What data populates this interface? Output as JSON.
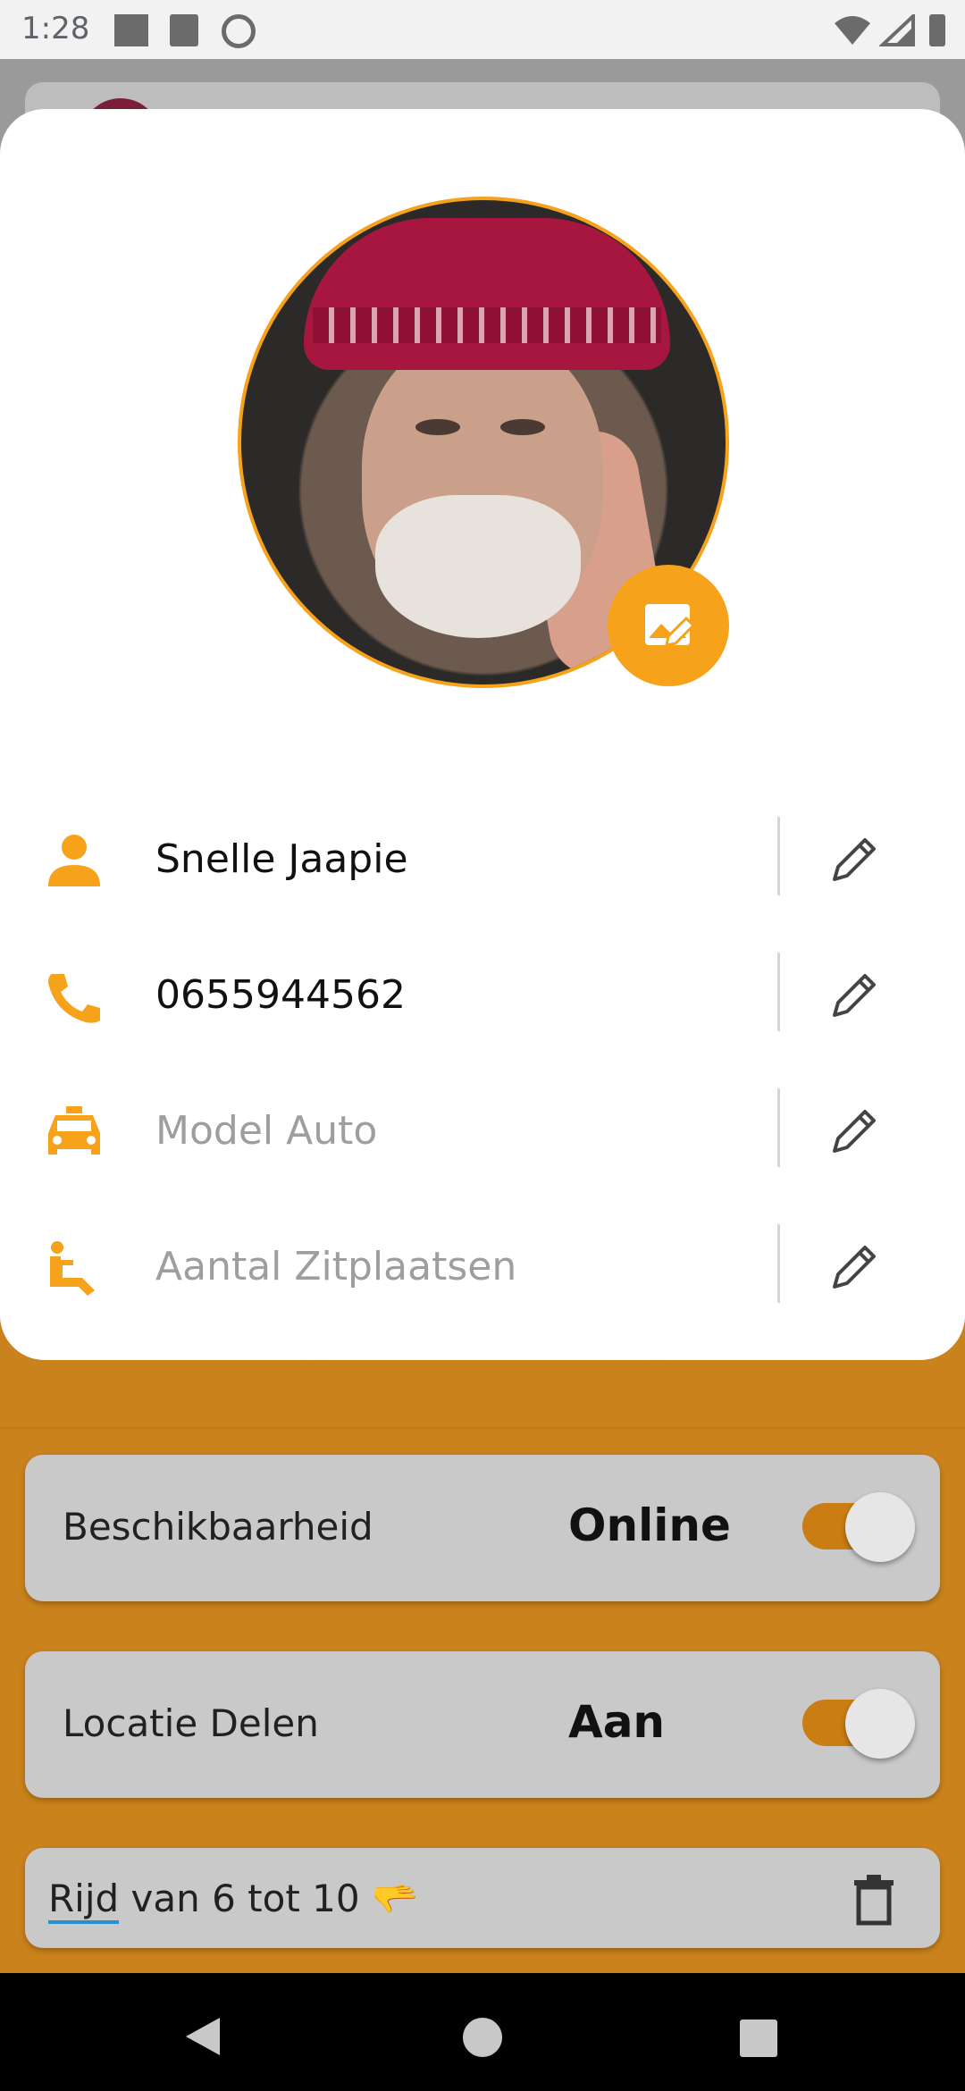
{
  "status_bar": {
    "time": "1:28"
  },
  "profile": {
    "name": "Snelle Jaapie",
    "phone": "0655944562",
    "car_model_placeholder": "Model Auto",
    "seats_placeholder": "Aantal Zitplaatsen"
  },
  "settings": {
    "availability": {
      "label": "Beschikbaarheid",
      "value": "Online",
      "on": true
    },
    "location": {
      "label": "Locatie Delen",
      "value": "Aan",
      "on": true
    }
  },
  "note": {
    "word1": "Rijd",
    "rest": " van 6 tot 10 ",
    "emoji": "🫳"
  },
  "colors": {
    "accent": "#f7a21b",
    "toggle": "#c97d12",
    "sheet_bg": "#ffffff"
  },
  "icons": {
    "name_row": "person-icon",
    "phone_row": "phone-icon",
    "car_row": "taxi-icon",
    "seats_row": "wheelchair-icon",
    "edit": "pencil-icon",
    "photo_edit": "image-edit-icon",
    "note_delete": "trash-icon"
  }
}
